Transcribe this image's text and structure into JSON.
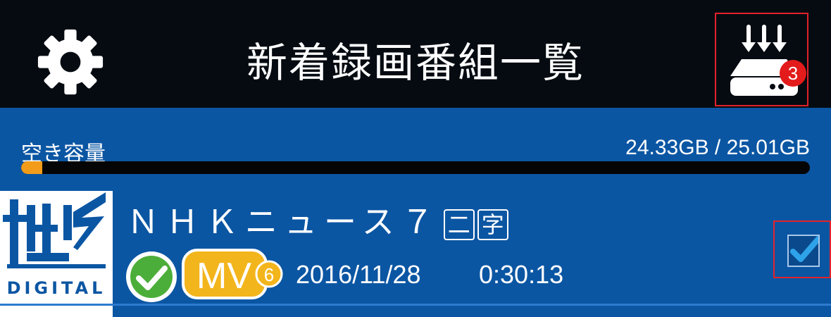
{
  "header": {
    "title": "新着録画番組一覧",
    "download_badge_count": "3",
    "settings_icon": "gear-icon",
    "download_icon": "download-to-device-icon"
  },
  "storage": {
    "label": "空き容量",
    "value": "24.33GB / 25.01GB",
    "used_fraction": 0.027
  },
  "recordings": [
    {
      "channel_logo_text": "DIGITAL",
      "title": "ＮＨＫニュース７",
      "tags": [
        "二",
        "字"
      ],
      "status_icon": "check-circle-icon",
      "mv_label": "MV",
      "mv_count": "6",
      "date": "2016/11/28",
      "duration": "0:30:13",
      "selected": true
    }
  ],
  "colors": {
    "topbar": "#050b11",
    "background": "#0b56a3",
    "accent": "#f39c1a",
    "badge": "#e31b1b",
    "highlight_border": "#e3222b"
  }
}
